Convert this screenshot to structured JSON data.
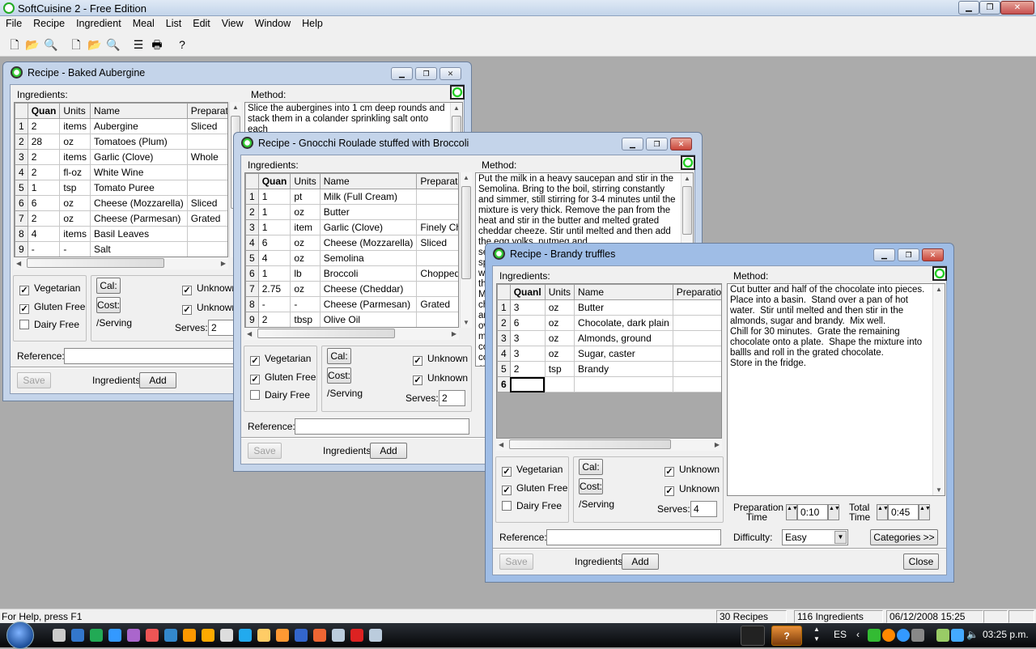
{
  "app": {
    "title": "SoftCuisine 2 - Free Edition"
  },
  "menu": [
    "File",
    "Recipe",
    "Ingredient",
    "Meal",
    "List",
    "Edit",
    "View",
    "Window",
    "Help"
  ],
  "toolbar": {
    "icons": [
      "new-recipe-icon",
      "open-recipe-icon",
      "find-recipe-icon",
      "new-ingredient-icon",
      "open-ingredient-icon",
      "find-ingredient-icon",
      "list-icon",
      "print-icon",
      "context-help-icon"
    ]
  },
  "windows": [
    {
      "title": "Recipe - Baked Aubergine",
      "ingredients_label": "Ingredients:",
      "method_label": "Method:",
      "columns": [
        "Quan",
        "Units",
        "Name",
        "Preparati"
      ],
      "rows": [
        [
          "1",
          "2",
          "items",
          "Aubergine",
          "Sliced"
        ],
        [
          "2",
          "28",
          "oz",
          "Tomatoes (Plum)",
          ""
        ],
        [
          "3",
          "2",
          "items",
          "Garlic (Clove)",
          "Whole"
        ],
        [
          "4",
          "2",
          "fl-oz",
          "White Wine",
          ""
        ],
        [
          "5",
          "1",
          "tsp",
          "Tomato Puree",
          ""
        ],
        [
          "6",
          "6",
          "oz",
          "Cheese (Mozzarella)",
          "Sliced"
        ],
        [
          "7",
          "2",
          "oz",
          "Cheese (Parmesan)",
          "Grated"
        ],
        [
          "8",
          "4",
          "items",
          "Basil Leaves",
          ""
        ],
        [
          "9",
          "-",
          "-",
          "Salt",
          ""
        ]
      ],
      "method": "Slice the aubergines into 1 cm deep rounds and stack them in a colander sprinkling salt onto each",
      "vegetarian": {
        "label": "Vegetarian",
        "checked": true
      },
      "gluten_free": {
        "label": "Gluten Free",
        "checked": true
      },
      "dairy_free": {
        "label": "Dairy Free",
        "checked": false
      },
      "cal_label": "Cal:",
      "cost_label": "Cost:",
      "per_serving": "/Serving",
      "unknown1": {
        "label": "Unknown",
        "checked": true
      },
      "unknown2": {
        "label": "Unknown",
        "checked": true
      },
      "serves_label": "Serves:",
      "serves": "2",
      "reference_label": "Reference:",
      "reference": "",
      "save_label": "Save",
      "ingredients_add_label": "Ingredients",
      "add_label": "Add"
    },
    {
      "title": "Recipe - Gnocchi Roulade stuffed with Broccoli",
      "ingredients_label": "Ingredients:",
      "method_label": "Method:",
      "columns": [
        "Quan",
        "Units",
        "Name",
        "Preparati"
      ],
      "rows": [
        [
          "1",
          "1",
          "pt",
          "Milk (Full Cream)",
          ""
        ],
        [
          "2",
          "1",
          "oz",
          "Butter",
          ""
        ],
        [
          "3",
          "1",
          "item",
          "Garlic (Clove)",
          "Finely Ch"
        ],
        [
          "4",
          "6",
          "oz",
          "Cheese (Mozzarella)",
          "Sliced"
        ],
        [
          "5",
          "4",
          "oz",
          "Semolina",
          ""
        ],
        [
          "6",
          "1",
          "lb",
          "Broccoli",
          "Chopped"
        ],
        [
          "7",
          "2.75",
          "oz",
          "Cheese (Cheddar)",
          ""
        ],
        [
          "8",
          "-",
          "-",
          "Cheese (Parmesan)",
          "Grated"
        ],
        [
          "9",
          "2",
          "tbsp",
          "Olive Oil",
          ""
        ]
      ],
      "method": "Put the milk in a heavy saucepan and stir in the Semolina. Bring to the boil, stirring constantly and simmer, still stirring for 3-4 minutes until the mixture is very thick. Remove the pan from the heat and stir in the butter and melted grated cheddar cheeze. Stir until melted and then add the egg yolks, nutmeg and\nse\nsp\nwi\nthe\nMe\nch\nan\nov\nmi\nco\nco\nov\nW",
      "vegetarian": {
        "label": "Vegetarian",
        "checked": true
      },
      "gluten_free": {
        "label": "Gluten Free",
        "checked": true
      },
      "dairy_free": {
        "label": "Dairy Free",
        "checked": false
      },
      "cal_label": "Cal:",
      "cost_label": "Cost:",
      "per_serving": "/Serving",
      "unknown1": {
        "label": "Unknown",
        "checked": true
      },
      "unknown2": {
        "label": "Unknown",
        "checked": true
      },
      "serves_label": "Serves:",
      "serves": "2",
      "reference_label": "Reference:",
      "reference": "",
      "save_label": "Save",
      "ingredients_add_label": "Ingredients",
      "add_label": "Add"
    },
    {
      "title": "Recipe - Brandy truffles",
      "ingredients_label": "Ingredients:",
      "method_label": "Method:",
      "columns": [
        "Quanl",
        "Units",
        "Name",
        "Preparation"
      ],
      "rows": [
        [
          "1",
          "3",
          "oz",
          "Butter",
          ""
        ],
        [
          "2",
          "6",
          "oz",
          "Chocolate, dark plain",
          ""
        ],
        [
          "3",
          "3",
          "oz",
          "Almonds, ground",
          ""
        ],
        [
          "4",
          "3",
          "oz",
          "Sugar, caster",
          ""
        ],
        [
          "5",
          "2",
          "tsp",
          "Brandy",
          ""
        ],
        [
          "6",
          "",
          "",
          "",
          ""
        ]
      ],
      "method": "Cut butter and half of the chocolate into pieces.  Place into a basin.  Stand over a pan of hot water.  Stir until melted and then stir in the almonds, sugar and brandy.  Mix well.\nChill for 30 minutes.  Grate the remaining chocolate onto a plate.  Shape the mixture into ballls and roll in the grated chocolate.\nStore in the fridge.",
      "vegetarian": {
        "label": "Vegetarian",
        "checked": true
      },
      "gluten_free": {
        "label": "Gluten Free",
        "checked": true
      },
      "dairy_free": {
        "label": "Dairy Free",
        "checked": false
      },
      "cal_label": "Cal:",
      "cost_label": "Cost:",
      "per_serving": "/Serving",
      "unknown1": {
        "label": "Unknown",
        "checked": true
      },
      "unknown2": {
        "label": "Unknown",
        "checked": true
      },
      "serves_label": "Serves:",
      "serves": "4",
      "reference_label": "Reference:",
      "reference": "",
      "save_label": "Save",
      "ingredients_add_label": "Ingredients",
      "add_label": "Add",
      "prep_time_label": "Preparation Time",
      "prep_time": "0:10",
      "total_time_label": "Total Time",
      "total_time": "0:45",
      "difficulty_label": "Difficulty:",
      "difficulty": "Easy",
      "categories_label": "Categories >>",
      "close_label": "Close"
    }
  ],
  "status": {
    "help": "For Help, press F1",
    "recipes": "30 Recipes",
    "ingredients": "116 Ingredients",
    "datetime": "06/12/2008 15:25"
  },
  "taskbar": {
    "language": "ES",
    "clock": "03:25 p.m."
  }
}
